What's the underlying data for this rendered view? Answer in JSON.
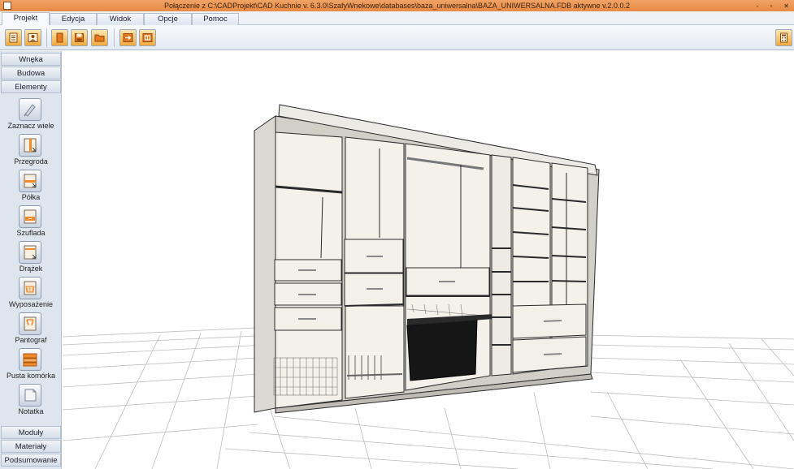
{
  "titlebar": {
    "title": "Połączenie z C:\\CADProjekt\\CAD Kuchnie v. 6.3.0\\SzafyWnekowe\\databases\\baza_uniwersalna\\BAZA_UNIWERSALNA.FDB aktywne   v.2.0.0.2",
    "minimize": "-",
    "restore": "▫",
    "close": "✕"
  },
  "tabs": [
    {
      "label": "Projekt",
      "active": true
    },
    {
      "label": "Edycja",
      "active": false
    },
    {
      "label": "Widok",
      "active": false
    },
    {
      "label": "Opcje",
      "active": false
    },
    {
      "label": "Pomoc",
      "active": false
    }
  ],
  "ribbon": {
    "buttons": [
      {
        "icon": "list-document-icon"
      },
      {
        "icon": "user-card-icon"
      },
      {
        "icon": "new-page-icon"
      },
      {
        "icon": "save-icon"
      },
      {
        "icon": "open-folder-icon"
      },
      {
        "icon": "export-arrow-icon"
      },
      {
        "icon": "import-frame-icon"
      }
    ],
    "right_button": {
      "icon": "calculator-icon"
    }
  },
  "sidebar": {
    "top_sections": [
      "Wnęka",
      "Budowa",
      "Elementy"
    ],
    "tools": [
      {
        "label": "Zaznacz wiele",
        "icon": "select-multiple-icon"
      },
      {
        "label": "Przegroda",
        "icon": "partition-icon"
      },
      {
        "label": "Półka",
        "icon": "shelf-icon"
      },
      {
        "label": "Szuflada",
        "icon": "drawer-icon"
      },
      {
        "label": "Drążek",
        "icon": "rod-icon"
      },
      {
        "label": "Wyposażenie",
        "icon": "equipment-icon"
      },
      {
        "label": "Pantograf",
        "icon": "pantograph-icon"
      },
      {
        "label": "Pusta komórka",
        "icon": "empty-cell-icon"
      },
      {
        "label": "Notatka",
        "icon": "note-icon"
      }
    ],
    "bottom_sections": [
      "Moduły",
      "Materiały",
      "Podsumowanie"
    ]
  },
  "colors": {
    "titlebar": "#e88a45",
    "accent": "#f2a93b",
    "board": "#e6e3dc",
    "front": "#f3f0e9",
    "edge": "#2a2a2a",
    "basket": "#161616"
  }
}
